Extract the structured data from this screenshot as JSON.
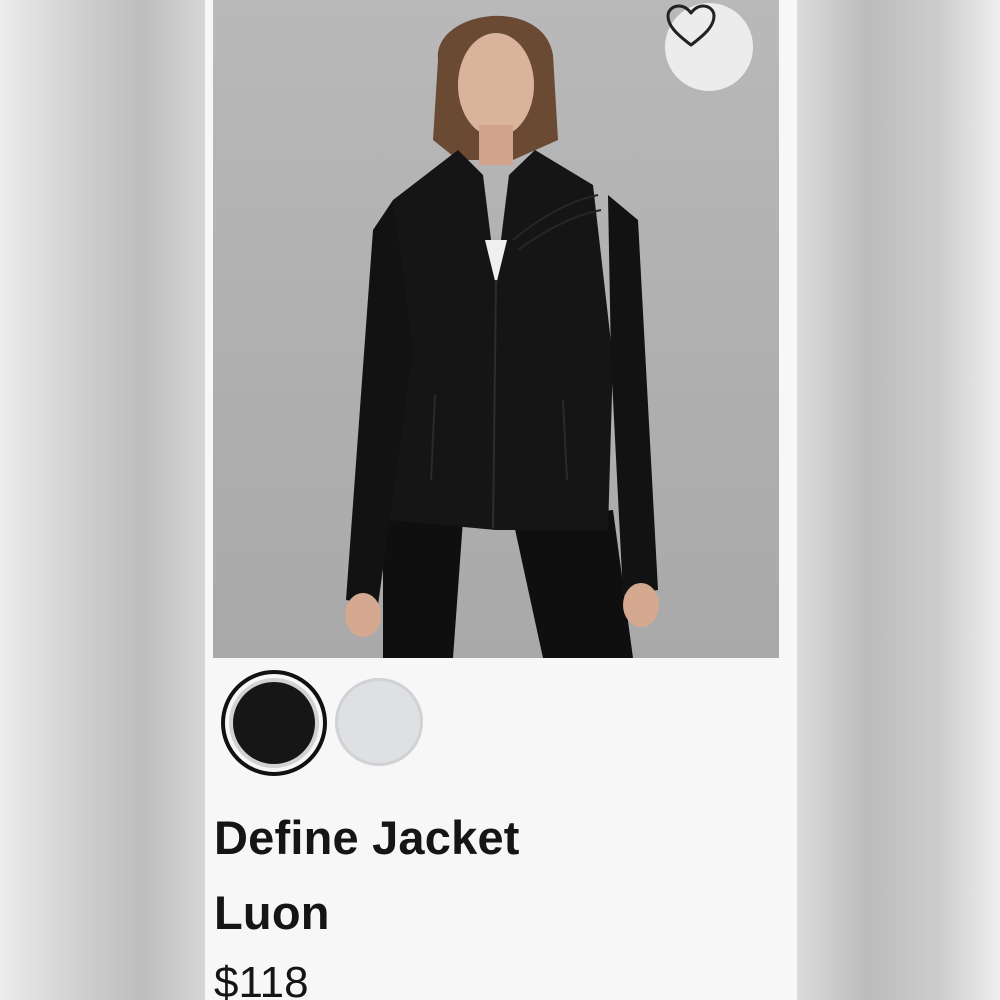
{
  "product": {
    "name_line1": "Define Jacket",
    "name_line2": "Luon",
    "price": "$118",
    "wishlist_icon": "heart-outline-icon"
  },
  "swatches": [
    {
      "color": "#161616",
      "selected": true
    },
    {
      "color": "#dfe0e2",
      "selected": false
    }
  ]
}
